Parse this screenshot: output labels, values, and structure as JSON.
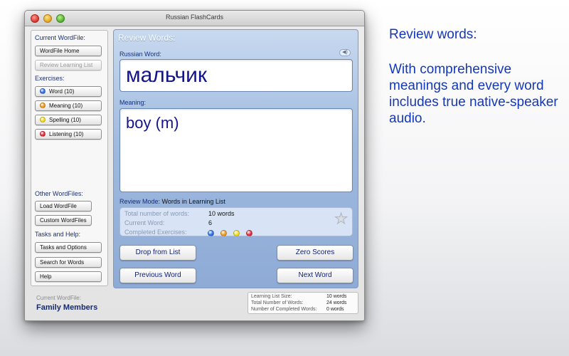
{
  "window": {
    "title": "Russian FlashCards"
  },
  "sidebar": {
    "current_wordfile_heading": "Current WordFile:",
    "wordfile_home": "WordFile Home",
    "review_learning_list": "Review Learning List",
    "exercises_heading": "Exercises:",
    "exercises": [
      {
        "label": "Word (10)",
        "color": "#2f6fe3"
      },
      {
        "label": "Meaning (10)",
        "color": "#f39a1c"
      },
      {
        "label": "Spelling (10)",
        "color": "#f3df1c"
      },
      {
        "label": "Listening (10)",
        "color": "#e32a3a"
      }
    ],
    "other_wordfiles_heading": "Other WordFiles:",
    "load_wordfile": "Load WordFile",
    "custom_wordfiles": "Custom WordFiles",
    "tasks_heading": "Tasks and Help:",
    "tasks_and_options": "Tasks and Options",
    "search_for_words": "Search for Words",
    "help": "Help"
  },
  "main": {
    "title": "Review Words:",
    "russian_word_label": "Russian Word:",
    "russian_word": "мальчик",
    "meaning_label": "Meaning:",
    "meaning": "boy (m)",
    "speaker_icon": "speaker-icon",
    "review_mode_label": "Review Mode:",
    "review_mode_value": "Words in Learning List",
    "stats": {
      "total_label": "Total number of words:",
      "total_value": "10 words",
      "current_label": "Current Word:",
      "current_value": "6",
      "completed_label": "Completed Exercises:",
      "completed_colors": [
        "#2f6fe3",
        "#f39a1c",
        "#f3df1c",
        "#e32a3a"
      ]
    },
    "drop_from_list": "Drop from List",
    "zero_scores": "Zero Scores",
    "previous_word": "Previous Word",
    "next_word": "Next Word"
  },
  "bottom": {
    "current_wordfile_label": "Current WordFile:",
    "current_wordfile_value": "Family Members",
    "learning_list_size_label": "Learning List Size:",
    "learning_list_size_value": "10 words",
    "total_words_label": "Total Number of Words:",
    "total_words_value": "24 words",
    "completed_words_label": "Number of Completed Words:",
    "completed_words_value": "0 words"
  },
  "promo": {
    "title": "Review words:",
    "body": "With comprehensive meanings and every word includes true native-speaker audio."
  }
}
